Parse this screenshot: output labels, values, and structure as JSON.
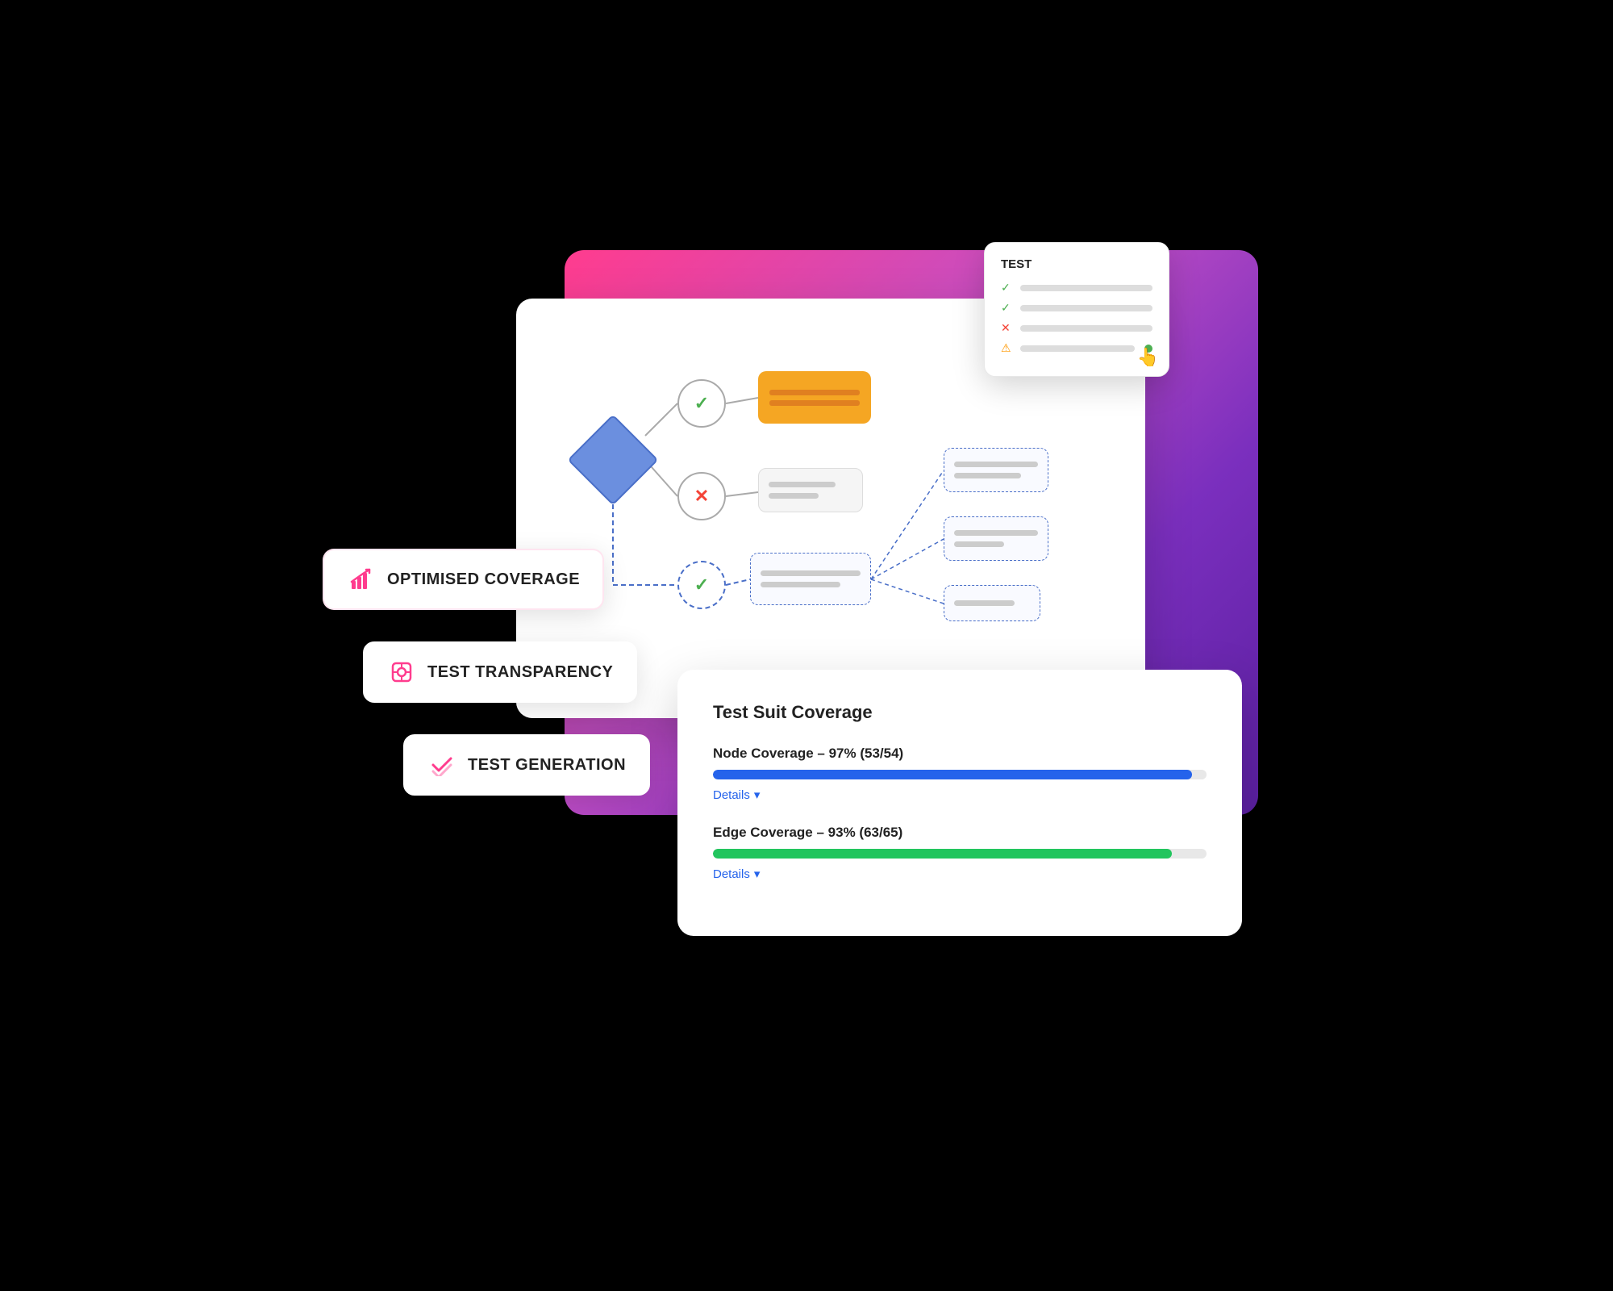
{
  "scene": {
    "badges": {
      "optimised": {
        "icon": "📈",
        "label": "OPTIMISED COVERAGE"
      },
      "transparency": {
        "icon": "🔍",
        "label": "TEST TRANSPARENCY"
      },
      "generation": {
        "icon": "✔",
        "label": "TEST GENERATION"
      }
    },
    "test_card": {
      "title": "TEST",
      "rows": [
        {
          "icon": "✔",
          "color": "#4caf50"
        },
        {
          "icon": "✔",
          "color": "#4caf50"
        },
        {
          "icon": "✘",
          "color": "#f44336"
        },
        {
          "icon": "⚠",
          "color": "#ff9800"
        }
      ]
    },
    "coverage_card": {
      "title": "Test Suit Coverage",
      "node_coverage": {
        "label": "Node Coverage – 97% (53/54)",
        "percent": 97,
        "details_link": "Details"
      },
      "edge_coverage": {
        "label": "Edge Coverage – 93% (63/65)",
        "percent": 93,
        "details_link": "Details"
      }
    }
  }
}
